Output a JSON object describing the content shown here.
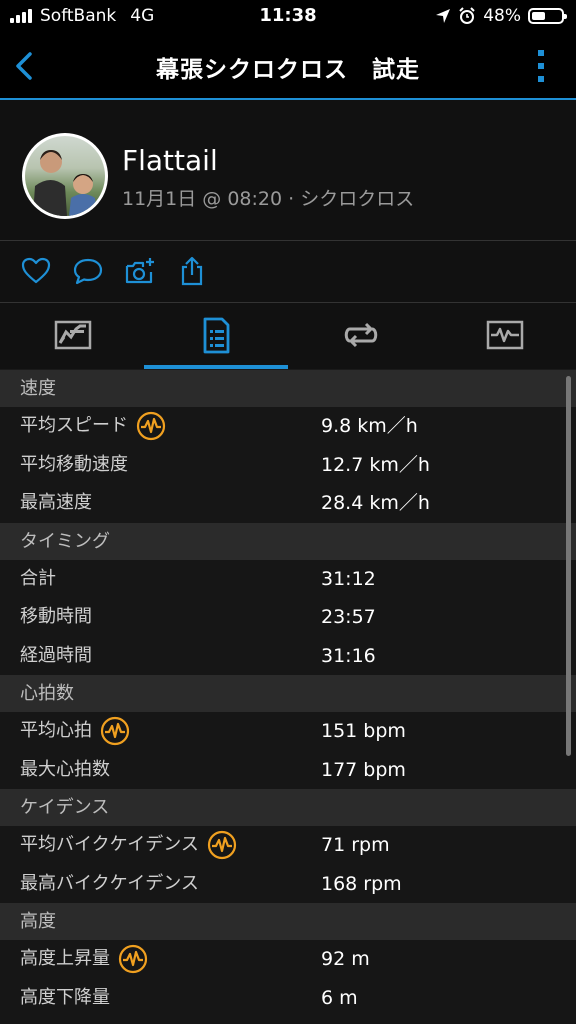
{
  "status": {
    "carrier": "SoftBank",
    "network": "4G",
    "time": "11:38",
    "battery": "48%",
    "icons": [
      "location-arrow-icon",
      "alarm-icon",
      "battery-icon"
    ]
  },
  "nav": {
    "title": "幕張シクロクロス　試走",
    "back_icon": "chevron-left-icon",
    "more_icon": "more-vertical-icon"
  },
  "profile": {
    "name": "Flattail",
    "subtitle": "11月1日 @ 08:20 · シクロクロス"
  },
  "actions": [
    "like-icon",
    "comment-icon",
    "add-photo-icon",
    "share-icon"
  ],
  "tabs": [
    {
      "icon": "overview-map-icon",
      "active": false
    },
    {
      "icon": "stats-list-icon",
      "active": true
    },
    {
      "icon": "laps-icon",
      "active": false
    },
    {
      "icon": "charts-icon",
      "active": false
    }
  ],
  "colors": {
    "accent": "#1e90d6",
    "badge": "#f0a020"
  },
  "sections": [
    {
      "title": "速度",
      "rows": [
        {
          "label": "平均スピード",
          "value": "9.8 km／h",
          "badge": true
        },
        {
          "label": "平均移動速度",
          "value": "12.7 km／h",
          "badge": false
        },
        {
          "label": "最高速度",
          "value": "28.4 km／h",
          "badge": false
        }
      ]
    },
    {
      "title": "タイミング",
      "rows": [
        {
          "label": "合計",
          "value": "31:12",
          "badge": false
        },
        {
          "label": "移動時間",
          "value": "23:57",
          "badge": false
        },
        {
          "label": "経過時間",
          "value": "31:16",
          "badge": false
        }
      ]
    },
    {
      "title": "心拍数",
      "rows": [
        {
          "label": "平均心拍",
          "value": "151 bpm",
          "badge": true
        },
        {
          "label": "最大心拍数",
          "value": "177 bpm",
          "badge": false
        }
      ]
    },
    {
      "title": "ケイデンス",
      "rows": [
        {
          "label": "平均バイクケイデンス",
          "value": "71 rpm",
          "badge": true
        },
        {
          "label": "最高バイクケイデンス",
          "value": "168 rpm",
          "badge": false
        }
      ]
    },
    {
      "title": "高度",
      "rows": [
        {
          "label": "高度上昇量",
          "value": "92 m",
          "badge": true
        },
        {
          "label": "高度下降量",
          "value": "6 m",
          "badge": false
        }
      ]
    }
  ]
}
